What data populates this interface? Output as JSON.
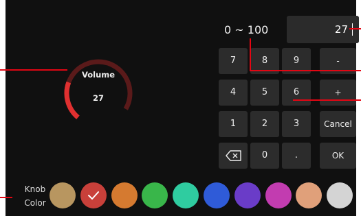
{
  "knob": {
    "label": "Volume",
    "value": "27",
    "level": 0.27,
    "arc_color": "#e03030",
    "track_color": "#5a1a1a"
  },
  "entry": {
    "range": "0 ~ 100",
    "value": "27"
  },
  "keypad": {
    "keys": [
      "7",
      "8",
      "9",
      "-",
      "4",
      "5",
      "6",
      "+",
      "1",
      "2",
      "3",
      "Cancel",
      "backspace",
      "0",
      ".",
      "OK"
    ]
  },
  "knob_color": {
    "label_line1": "Knob",
    "label_line2": "Color",
    "swatches": [
      "#b89660",
      "#c8403a",
      "#d57a30",
      "#39b64a",
      "#2fcca0",
      "#2f5bd8",
      "#6a3cc8",
      "#c23cb0",
      "#e0a07a",
      "#d4d4d4"
    ],
    "selected_index": 1
  },
  "annotation_color": "#e30613"
}
